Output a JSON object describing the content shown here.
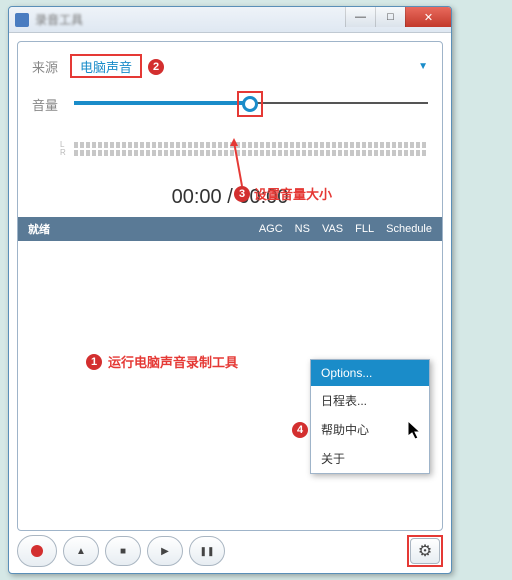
{
  "window": {
    "title": "录音工具"
  },
  "source": {
    "label": "来源",
    "value": "电脑声音"
  },
  "volume": {
    "label": "音量",
    "percent": 48,
    "left": "L",
    "right": "R"
  },
  "callouts": {
    "c1": "运行电脑声音录制工具",
    "c2": "",
    "c3": "设置音量大小",
    "n1": "1",
    "n2": "2",
    "n3": "3",
    "n4": "4"
  },
  "time": {
    "display": "00:00 / 00:00"
  },
  "status": {
    "ready": "就绪",
    "items": [
      "AGC",
      "NS",
      "VAS",
      "FLL",
      "Schedule"
    ]
  },
  "menu": {
    "options": "Options...",
    "schedule": "日程表...",
    "help": "帮助中心",
    "about": "关于"
  },
  "icons": {
    "minimize": "—",
    "maximize": "□",
    "close": "✕",
    "eject": "▲",
    "stop": "■",
    "play": "▶",
    "pause": "❚❚",
    "gear": "⚙",
    "dropdown": "▼"
  }
}
